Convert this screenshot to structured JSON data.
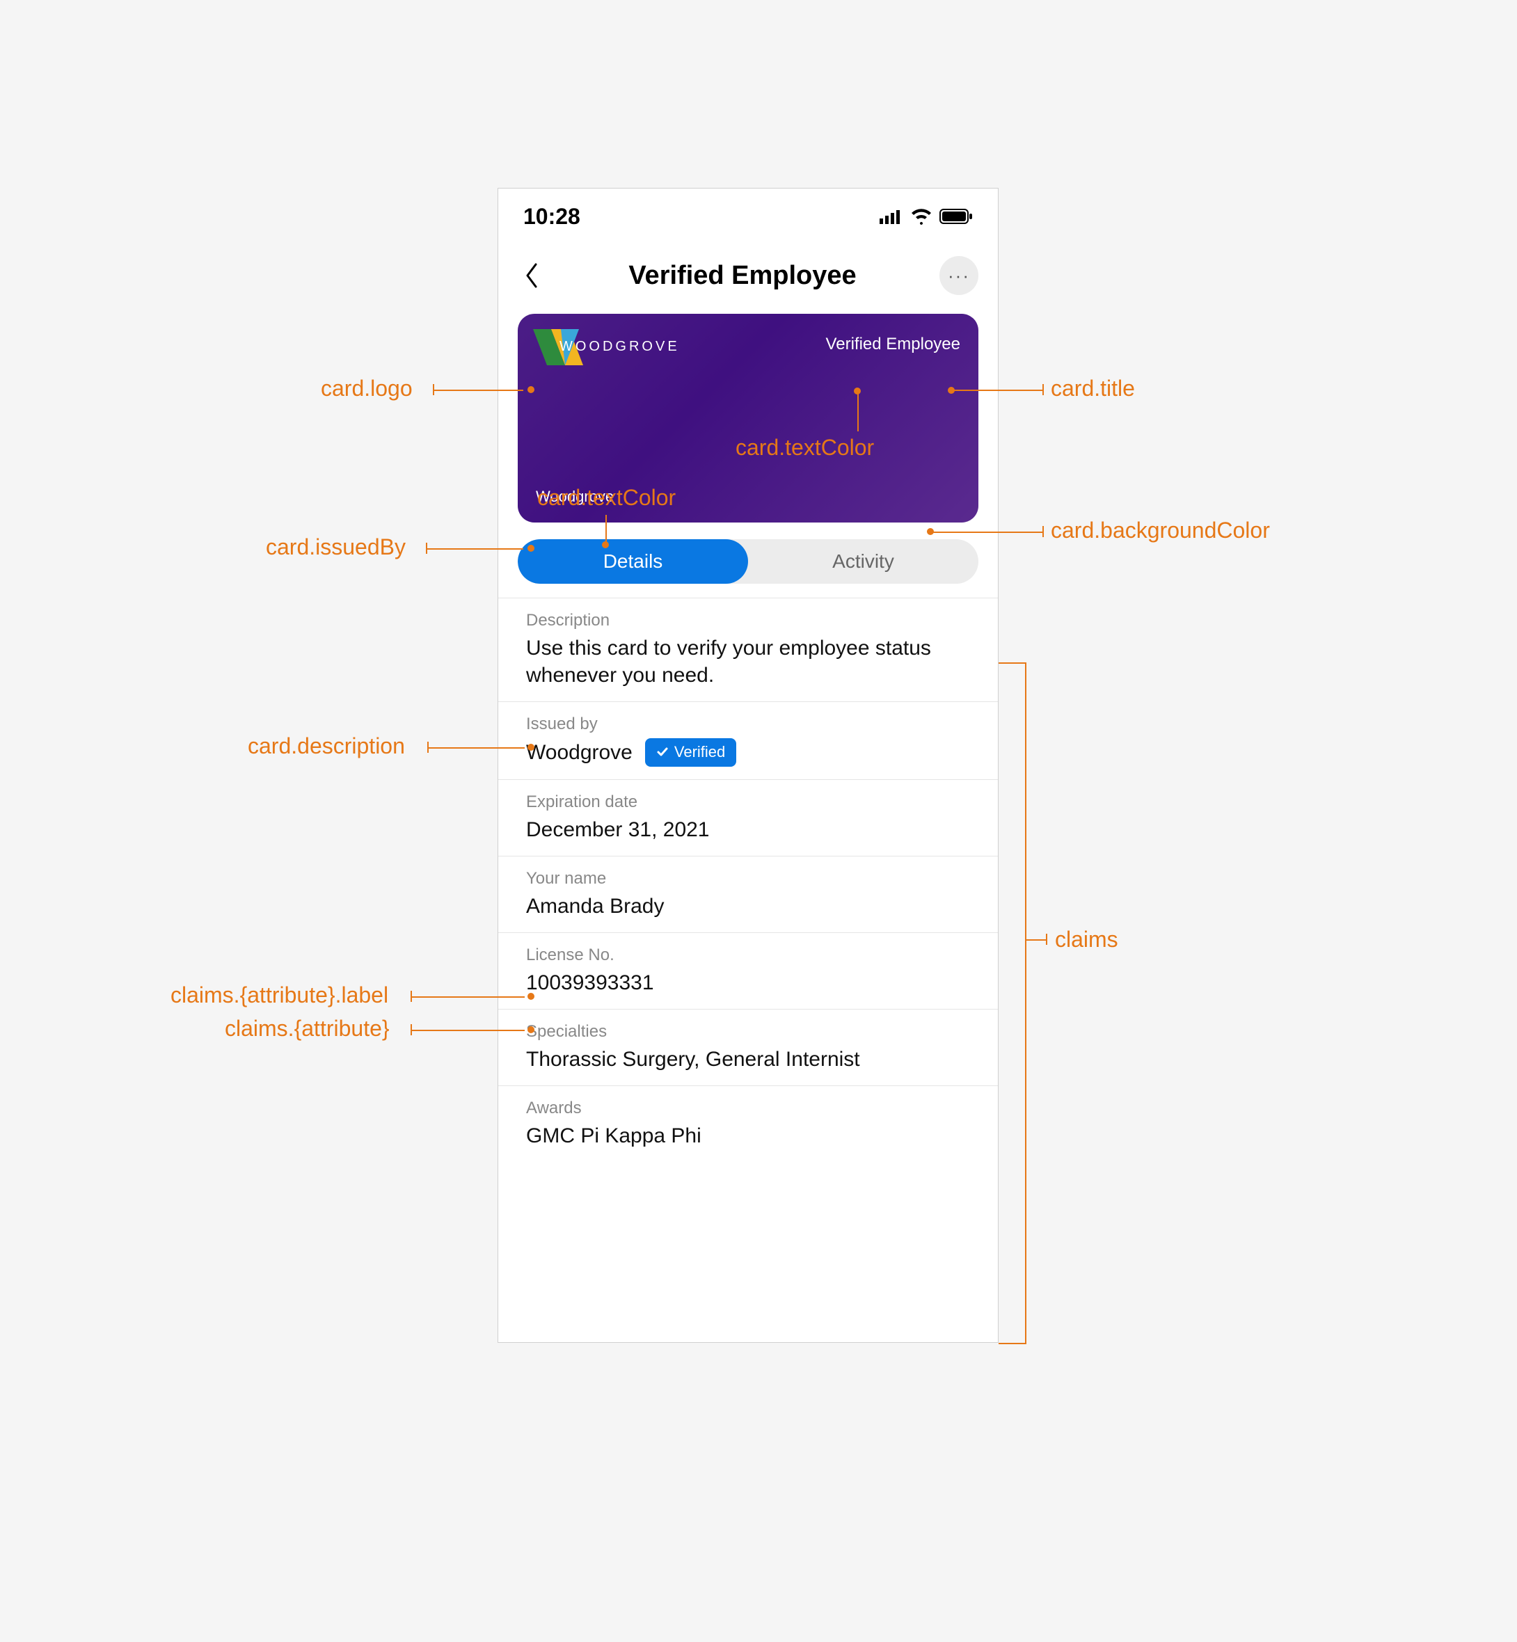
{
  "status": {
    "time": "10:28"
  },
  "nav": {
    "title": "Verified Employee",
    "more": "···"
  },
  "card": {
    "brand": "WOODGROVE",
    "title": "Verified Employee",
    "issuedBy": "Woodgrove"
  },
  "tabs": {
    "details": "Details",
    "activity": "Activity"
  },
  "details": {
    "description_label": "Description",
    "description": "Use this card to verify your employee status whenever you need.",
    "issuedby_label": "Issued by",
    "issuedby": "Woodgrove",
    "verified_badge": "Verified",
    "expiration_label": "Expiration date",
    "expiration": "December 31, 2021",
    "name_label": "Your name",
    "name": "Amanda Brady",
    "license_label": "License No.",
    "license": "10039393331",
    "specialties_label": "Specialties",
    "specialties": "Thorassic Surgery, General Internist",
    "awards_label": "Awards",
    "awards": "GMC Pi Kappa Phi"
  },
  "annotations": {
    "logo": "card.logo",
    "title": "card.title",
    "textColor1": "card.textColor",
    "textColor2": "card.textColor",
    "issuedBy": "card.issuedBy",
    "background": "card.backgroundColor",
    "description": "card.description",
    "claimLabel": "claims.{attribute}.label",
    "claimValue": "claims.{attribute}",
    "claims": "claims"
  }
}
